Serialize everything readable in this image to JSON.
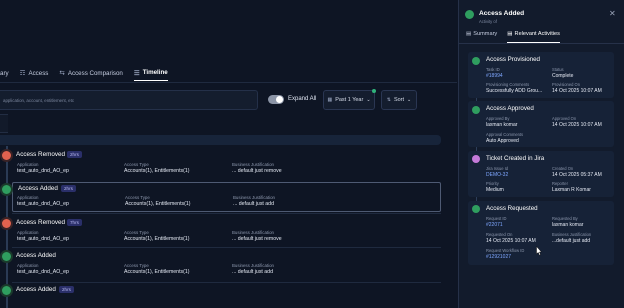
{
  "tabs": [
    {
      "label": "ary",
      "icon": "",
      "active": false
    },
    {
      "label": "Access",
      "icon": "users-icon",
      "active": false
    },
    {
      "label": "Access Comparison",
      "icon": "compare-icon",
      "active": false
    },
    {
      "label": "Timeline",
      "icon": "timeline-icon",
      "active": true
    }
  ],
  "filter": {
    "placeholder": "application, account, entitlement, etc"
  },
  "toolbar": {
    "expand_all": "Expand All",
    "expand_on": true,
    "period": "Past 1 Year",
    "sort": "Sort"
  },
  "timeline": [
    {
      "title": "Access Removed",
      "badge": "2hrs",
      "status": "removed",
      "cols": [
        {
          "label": "Application",
          "value": "test_auto_dnd_AO_ep"
        },
        {
          "label": "Access Type",
          "value": "Accounts(1), Entitlements(1)"
        },
        {
          "label": "Business Justification",
          "value": "... default just remove"
        }
      ]
    },
    {
      "title": "Access Added",
      "badge": "2hrs",
      "status": "added",
      "cols": [
        {
          "label": "Application",
          "value": "test_auto_dnd_AO_ep"
        },
        {
          "label": "Access Type",
          "value": "Accounts(1), Entitlements(1)"
        },
        {
          "label": "Business Justification",
          "value": "... default just add"
        }
      ]
    },
    {
      "title": "Access Removed",
      "badge": "7hrs",
      "status": "removed",
      "cols": [
        {
          "label": "Application",
          "value": "test_auto_dnd_AO_ep"
        },
        {
          "label": "Access Type",
          "value": "Accounts(1), Entitlements(1)"
        },
        {
          "label": "Business Justification",
          "value": "... default just remove"
        }
      ]
    },
    {
      "title": "Access Added",
      "badge": "",
      "status": "added",
      "cols": [
        {
          "label": "Application",
          "value": "test_auto_dnd_AO_ep"
        },
        {
          "label": "Access Type",
          "value": "Accounts(1), Entitlements(1)"
        },
        {
          "label": "Business Justification",
          "value": "... default just add"
        }
      ]
    },
    {
      "title": "Access Added",
      "badge": "2hrs",
      "status": "added",
      "cols": []
    }
  ],
  "panel": {
    "title": "Access Added",
    "subtitle": "Activity of",
    "tabs": [
      {
        "label": "Summary",
        "icon": "document-icon"
      },
      {
        "label": "Relevant Activities",
        "icon": "document-icon"
      }
    ],
    "cards": [
      {
        "title": "Access Provisioned",
        "marker": "green",
        "fields": [
          {
            "label": "Task ID",
            "value": "#18994",
            "link": true
          },
          {
            "label": "Status",
            "value": "Complete"
          },
          {
            "label": "Provisioning Comments",
            "value": "Successfully ADD Grou..."
          },
          {
            "label": "Provisioned On",
            "value": "14 Oct 2025 10:07 AM"
          }
        ]
      },
      {
        "title": "Access Approved",
        "marker": "green",
        "fields": [
          {
            "label": "Approved By",
            "value": "laxman komar"
          },
          {
            "label": "Approved On",
            "value": "14 Oct 2025 10:07 AM"
          },
          {
            "label": "Approval Comments",
            "value": "Auto Approved"
          }
        ]
      },
      {
        "title": "Ticket Created in Jira",
        "marker": "purple",
        "fields": [
          {
            "label": "Jira Issue Id",
            "value": "DEMO-32",
            "link": true
          },
          {
            "label": "Created On",
            "value": "14 Oct 2025 05:37 AM"
          },
          {
            "label": "Priority",
            "value": "Medium"
          },
          {
            "label": "Reporter",
            "value": "Laxman R Komar"
          }
        ]
      },
      {
        "title": "Access Requested",
        "marker": "green",
        "fields": [
          {
            "label": "Request ID",
            "value": "#22071",
            "link": true
          },
          {
            "label": "Requested By",
            "value": "laxman komar"
          },
          {
            "label": "Requested On",
            "value": "14 Oct 2025 10:07 AM"
          },
          {
            "label": "Business Justification",
            "value": "...default just add"
          },
          {
            "label": "Request Workflow ID",
            "value": "#12921027",
            "link": true
          }
        ]
      }
    ]
  },
  "colors": {
    "background": "#0e1524",
    "panel": "#121b2c",
    "added": "#2f9e5f",
    "removed": "#e2624f",
    "jira": "#c47ad8",
    "link": "#7fa7ff"
  }
}
